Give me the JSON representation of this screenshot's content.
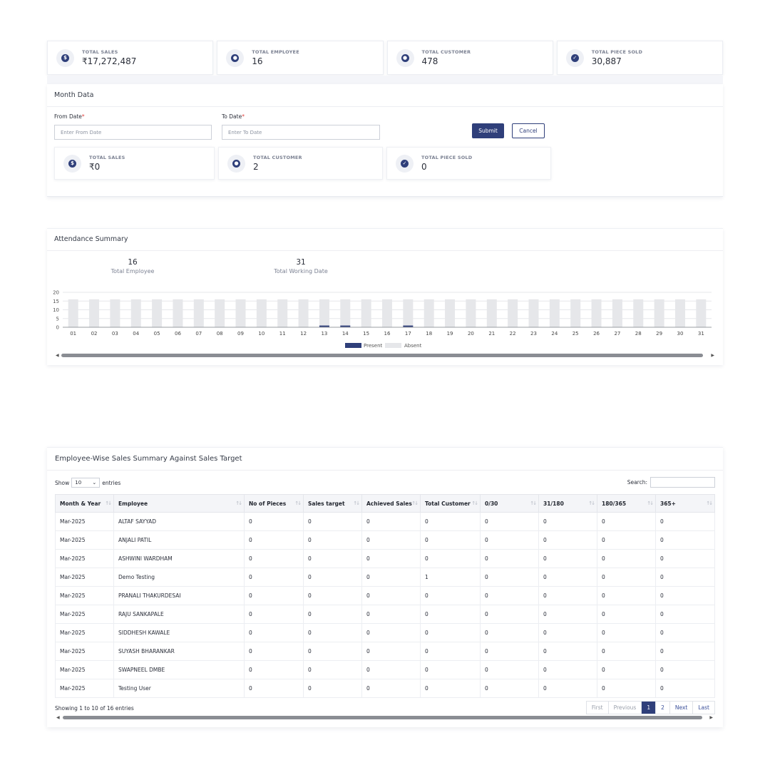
{
  "stats": [
    {
      "label": "TOTAL SALES",
      "value": "₹17,272,487",
      "icon": "dollar-icon",
      "glyph": "$"
    },
    {
      "label": "TOTAL EMPLOYEE",
      "value": "16",
      "icon": "user-icon",
      "glyph": "●"
    },
    {
      "label": "TOTAL CUSTOMER",
      "value": "478",
      "icon": "user-icon",
      "glyph": "●"
    },
    {
      "label": "TOTAL PIECE SOLD",
      "value": "30,887",
      "icon": "check-icon",
      "glyph": "✓"
    }
  ],
  "month": {
    "title": "Month Data",
    "from_label": "From Date",
    "to_label": "To Date",
    "required_mark": "*",
    "from_placeholder": "Enter From Date",
    "to_placeholder": "Enter To Date",
    "submit_label": "Submit",
    "cancel_label": "Cancel",
    "cards": [
      {
        "label": "TOTAL SALES",
        "value": "₹0",
        "icon": "dollar-icon",
        "glyph": "$"
      },
      {
        "label": "TOTAL CUSTOMER",
        "value": "2",
        "icon": "user-icon",
        "glyph": "●"
      },
      {
        "label": "TOTAL PIECE SOLD",
        "value": "0",
        "icon": "check-icon",
        "glyph": "✓"
      }
    ]
  },
  "attendance": {
    "title": "Attendance Summary",
    "total_employee_value": "16",
    "total_employee_label": "Total Employee",
    "working_date_value": "31",
    "working_date_label": "Total Working Date"
  },
  "chart_data": {
    "type": "bar",
    "stacked": true,
    "categories": [
      "01",
      "02",
      "03",
      "04",
      "05",
      "06",
      "07",
      "08",
      "09",
      "10",
      "11",
      "12",
      "13",
      "14",
      "15",
      "16",
      "17",
      "18",
      "19",
      "20",
      "21",
      "22",
      "23",
      "24",
      "25",
      "26",
      "27",
      "28",
      "29",
      "30",
      "31"
    ],
    "series": [
      {
        "name": "Present",
        "color": "#2f3f7a",
        "values": [
          0,
          0,
          0,
          0,
          0,
          0,
          0,
          0,
          0,
          0,
          0,
          0,
          1,
          1,
          0,
          0,
          1,
          0,
          0,
          0,
          0,
          0,
          0,
          0,
          0,
          0,
          0,
          0,
          0,
          0,
          0
        ]
      },
      {
        "name": "Absent",
        "color": "#e6e7ea",
        "values": [
          16,
          16,
          16,
          16,
          16,
          16,
          16,
          16,
          16,
          16,
          16,
          16,
          15,
          15,
          16,
          16,
          15,
          16,
          16,
          16,
          16,
          16,
          16,
          16,
          16,
          16,
          16,
          16,
          16,
          16,
          16
        ]
      }
    ],
    "yticks": [
      "0",
      "5",
      "10",
      "15",
      "20"
    ],
    "ylim": [
      0,
      20
    ],
    "grid": true,
    "legend": "bottom"
  },
  "sales": {
    "title": "Employee-Wise Sales Summary Against Sales Target",
    "show_label": "Show",
    "page_size": "10",
    "entries_label": "entries",
    "search_label": "Search:",
    "columns": [
      "Month & Year",
      "Employee",
      "No of Pieces",
      "Sales target",
      "Achieved Sales",
      "Total Customer",
      "0/30",
      "31/180",
      "180/365",
      "365+"
    ],
    "rows": [
      [
        "Mar-2025",
        "ALTAF SAYYAD",
        "0",
        "0",
        "0",
        "0",
        "0",
        "0",
        "0",
        "0"
      ],
      [
        "Mar-2025",
        "ANJALI PATIL",
        "0",
        "0",
        "0",
        "0",
        "0",
        "0",
        "0",
        "0"
      ],
      [
        "Mar-2025",
        "ASHWINI WARDHAM",
        "0",
        "0",
        "0",
        "0",
        "0",
        "0",
        "0",
        "0"
      ],
      [
        "Mar-2025",
        "Demo Testing",
        "0",
        "0",
        "0",
        "1",
        "0",
        "0",
        "0",
        "0"
      ],
      [
        "Mar-2025",
        "PRANALI THAKURDESAI",
        "0",
        "0",
        "0",
        "0",
        "0",
        "0",
        "0",
        "0"
      ],
      [
        "Mar-2025",
        "RAJU SANKAPALE",
        "0",
        "0",
        "0",
        "0",
        "0",
        "0",
        "0",
        "0"
      ],
      [
        "Mar-2025",
        "SIDDHESH KAWALE",
        "0",
        "0",
        "0",
        "0",
        "0",
        "0",
        "0",
        "0"
      ],
      [
        "Mar-2025",
        "SUYASH BHARANKAR",
        "0",
        "0",
        "0",
        "0",
        "0",
        "0",
        "0",
        "0"
      ],
      [
        "Mar-2025",
        "SWAPNEEL DMBE",
        "0",
        "0",
        "0",
        "0",
        "0",
        "0",
        "0",
        "0"
      ],
      [
        "Mar-2025",
        "Testing User",
        "0",
        "0",
        "0",
        "0",
        "0",
        "0",
        "0",
        "0"
      ]
    ],
    "footer_info": "Showing 1 to 10 of 16 entries",
    "pager": [
      {
        "label": "First",
        "state": "disabled"
      },
      {
        "label": "Previous",
        "state": "disabled"
      },
      {
        "label": "1",
        "state": "active"
      },
      {
        "label": "2",
        "state": "link"
      },
      {
        "label": "Next",
        "state": "link"
      },
      {
        "label": "Last",
        "state": "link"
      }
    ]
  }
}
